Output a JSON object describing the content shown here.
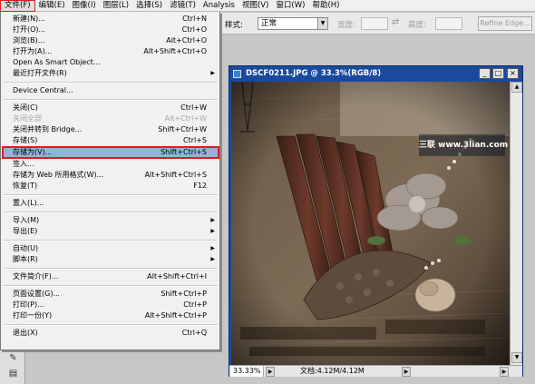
{
  "menubar": {
    "items": [
      {
        "label": "文件(F)"
      },
      {
        "label": "编辑(E)"
      },
      {
        "label": "图像(I)"
      },
      {
        "label": "图层(L)"
      },
      {
        "label": "选择(S)"
      },
      {
        "label": "滤镜(T)"
      },
      {
        "label": "Analysis"
      },
      {
        "label": "视图(V)"
      },
      {
        "label": "窗口(W)"
      },
      {
        "label": "帮助(H)"
      }
    ]
  },
  "options": {
    "style_label": "样式:",
    "style_value": "正常",
    "width_label": "宽度:",
    "height_label": "高度:",
    "refine_edge": "Refine Edge..."
  },
  "file_menu": {
    "items": [
      {
        "label": "新建(N)...",
        "shortcut": "Ctrl+N"
      },
      {
        "label": "打开(O)...",
        "shortcut": "Ctrl+O"
      },
      {
        "label": "浏览(B)...",
        "shortcut": "Alt+Ctrl+O"
      },
      {
        "label": "打开为(A)...",
        "shortcut": "Alt+Shift+Ctrl+O"
      },
      {
        "label": "Open As Smart Object...",
        "shortcut": ""
      },
      {
        "label": "最近打开文件(R)",
        "shortcut": ""
      },
      {
        "label": "Device Central...",
        "shortcut": ""
      },
      {
        "label": "关闭(C)",
        "shortcut": "Ctrl+W"
      },
      {
        "label": "关闭全部",
        "shortcut": "Alt+Ctrl+W"
      },
      {
        "label": "关闭并转到 Bridge...",
        "shortcut": "Shift+Ctrl+W"
      },
      {
        "label": "存储(S)",
        "shortcut": "Ctrl+S"
      },
      {
        "label": "存储为(V)...",
        "shortcut": "Shift+Ctrl+S"
      },
      {
        "label": "签入...",
        "shortcut": ""
      },
      {
        "label": "存储为 Web 所用格式(W)...",
        "shortcut": "Alt+Shift+Ctrl+S"
      },
      {
        "label": "恢复(T)",
        "shortcut": "F12"
      },
      {
        "label": "置入(L)...",
        "shortcut": ""
      },
      {
        "label": "导入(M)",
        "shortcut": ""
      },
      {
        "label": "导出(E)",
        "shortcut": ""
      },
      {
        "label": "自动(U)",
        "shortcut": ""
      },
      {
        "label": "脚本(R)",
        "shortcut": ""
      },
      {
        "label": "文件简介(F)...",
        "shortcut": "Alt+Shift+Ctrl+I"
      },
      {
        "label": "页面设置(G)...",
        "shortcut": "Shift+Ctrl+P"
      },
      {
        "label": "打印(P)...",
        "shortcut": "Ctrl+P"
      },
      {
        "label": "打印一份(Y)",
        "shortcut": "Alt+Shift+Ctrl+P"
      },
      {
        "label": "退出(X)",
        "shortcut": "Ctrl+Q"
      }
    ]
  },
  "document": {
    "title": "DSCF0211.JPG @ 33.3%(RGB/8)",
    "zoom": "33.33%",
    "doc_size": "文档:4.12M/4.12M",
    "watermark": "三联 www.3lian.com"
  },
  "colors": {
    "menu_highlight": "#93b3d9",
    "highlight_border": "#d42020",
    "titlebar": "#1a4aa0"
  }
}
